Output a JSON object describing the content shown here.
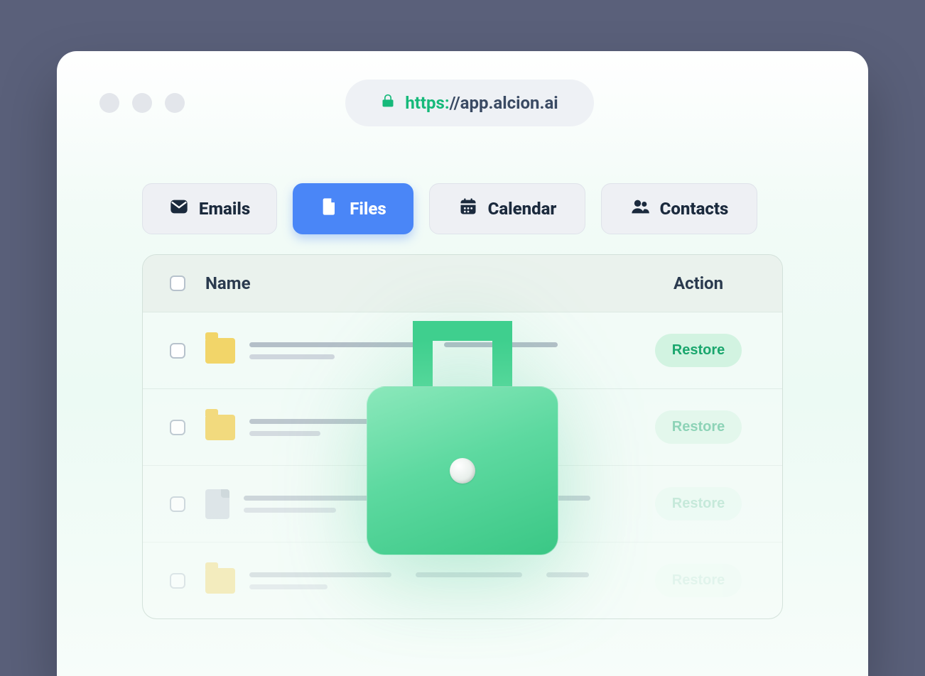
{
  "address": {
    "protocol": "https:",
    "rest": "//app.alcion.ai"
  },
  "tabs": [
    {
      "id": "emails",
      "label": "Emails",
      "active": false
    },
    {
      "id": "files",
      "label": "Files",
      "active": true
    },
    {
      "id": "calendar",
      "label": "Calendar",
      "active": false
    },
    {
      "id": "contacts",
      "label": "Contacts",
      "active": false
    }
  ],
  "table": {
    "columns": {
      "name": "Name",
      "action": "Action"
    },
    "rows": [
      {
        "type": "folder",
        "action": "Restore"
      },
      {
        "type": "folder",
        "action": "Restore"
      },
      {
        "type": "file",
        "action": "Restore"
      },
      {
        "type": "folder",
        "action": "Restore"
      }
    ]
  }
}
